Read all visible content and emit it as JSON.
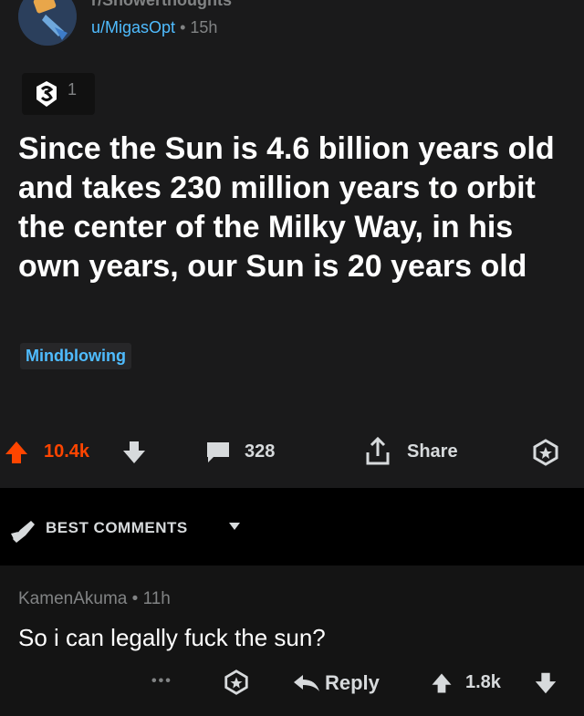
{
  "post": {
    "subreddit": "r/Showerthoughts",
    "author": "u/MigasOpt",
    "separator": "•",
    "age": "15h",
    "award_count": "1",
    "title": "Since the Sun is 4.6 billion years old and takes 230 million years to orbit the center of the Milky Way, in his own years, our Sun is 20 years old",
    "flair": "Mindblowing",
    "score": "10.4k",
    "comments": "328",
    "share_label": "Share"
  },
  "sort": {
    "label": "BEST COMMENTS"
  },
  "comment": {
    "author": "KamenAkuma",
    "separator": "•",
    "age": "11h",
    "body": "So i can legally fuck the sun?",
    "more": "•••",
    "reply_label": "Reply",
    "score": "1.8k"
  },
  "colors": {
    "upvote": "#ff4500",
    "link": "#4fbcff",
    "muted": "#818384"
  }
}
